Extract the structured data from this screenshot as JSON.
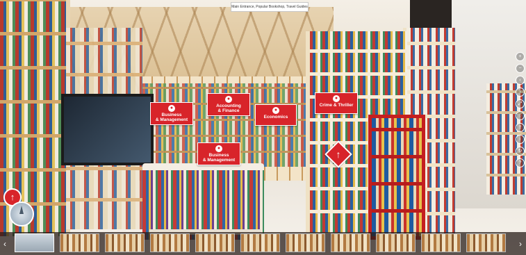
{
  "location": {
    "title": "Main Entrance, Popular Bookshop, Travel Guides"
  },
  "hotspots": {
    "business_management": {
      "label": "Business\n& Management"
    },
    "accounting_finance": {
      "label": "Accounting\n& Finance"
    },
    "economics": {
      "label": "Economics"
    },
    "crime_thriller": {
      "label": "Crime & Thriller"
    },
    "business_management_2": {
      "label": "Business\n& Management"
    }
  },
  "icons": {
    "hotspot": "info-circle-icon",
    "nav": "arrow-up-icon",
    "controls": [
      "zoom-in-icon",
      "zoom-out-icon",
      "rotate-left-icon",
      "rotate-right-icon",
      "fullscreen-icon",
      "hide-icon",
      "share-icon",
      "info-icon",
      "autorotate-icon",
      "help-icon"
    ]
  },
  "colors": {
    "accent": "#d8242a",
    "thumb_bar": "#2b211c"
  },
  "thumbnails": {
    "count": 11,
    "active_index": 0
  }
}
